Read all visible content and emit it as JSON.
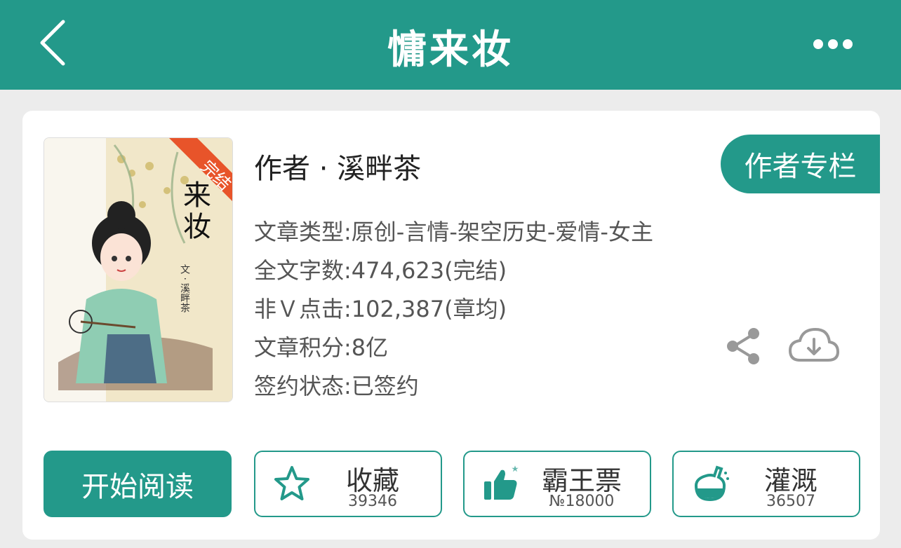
{
  "header": {
    "title": "慵来妆",
    "back_icon": "chevron-left-icon",
    "more_icon": "more-dots-icon"
  },
  "book": {
    "cover_title": "慵来妆",
    "cover_badge": "完结",
    "cover_author_line": "文 · 溪畔茶",
    "author_line": "作者 · 溪畔茶",
    "author_column_label": "作者专栏",
    "meta": [
      "文章类型:原创-言情-架空历史-爱情-女主",
      "全文字数:474,623(完结)",
      "非Ｖ点击:102,387(章均)",
      "文章积分:8亿",
      "签约状态:已签约"
    ]
  },
  "actions": {
    "read_label": "开始阅读",
    "collect": {
      "label": "收藏",
      "count": "39346",
      "icon": "star-icon"
    },
    "vote": {
      "label": "霸王票",
      "count": "№18000",
      "icon": "thumbs-up-icon"
    },
    "water": {
      "label": "灌溉",
      "count": "36507",
      "icon": "flask-icon"
    }
  },
  "colors": {
    "accent": "#23998a",
    "badge": "#e8542a"
  }
}
